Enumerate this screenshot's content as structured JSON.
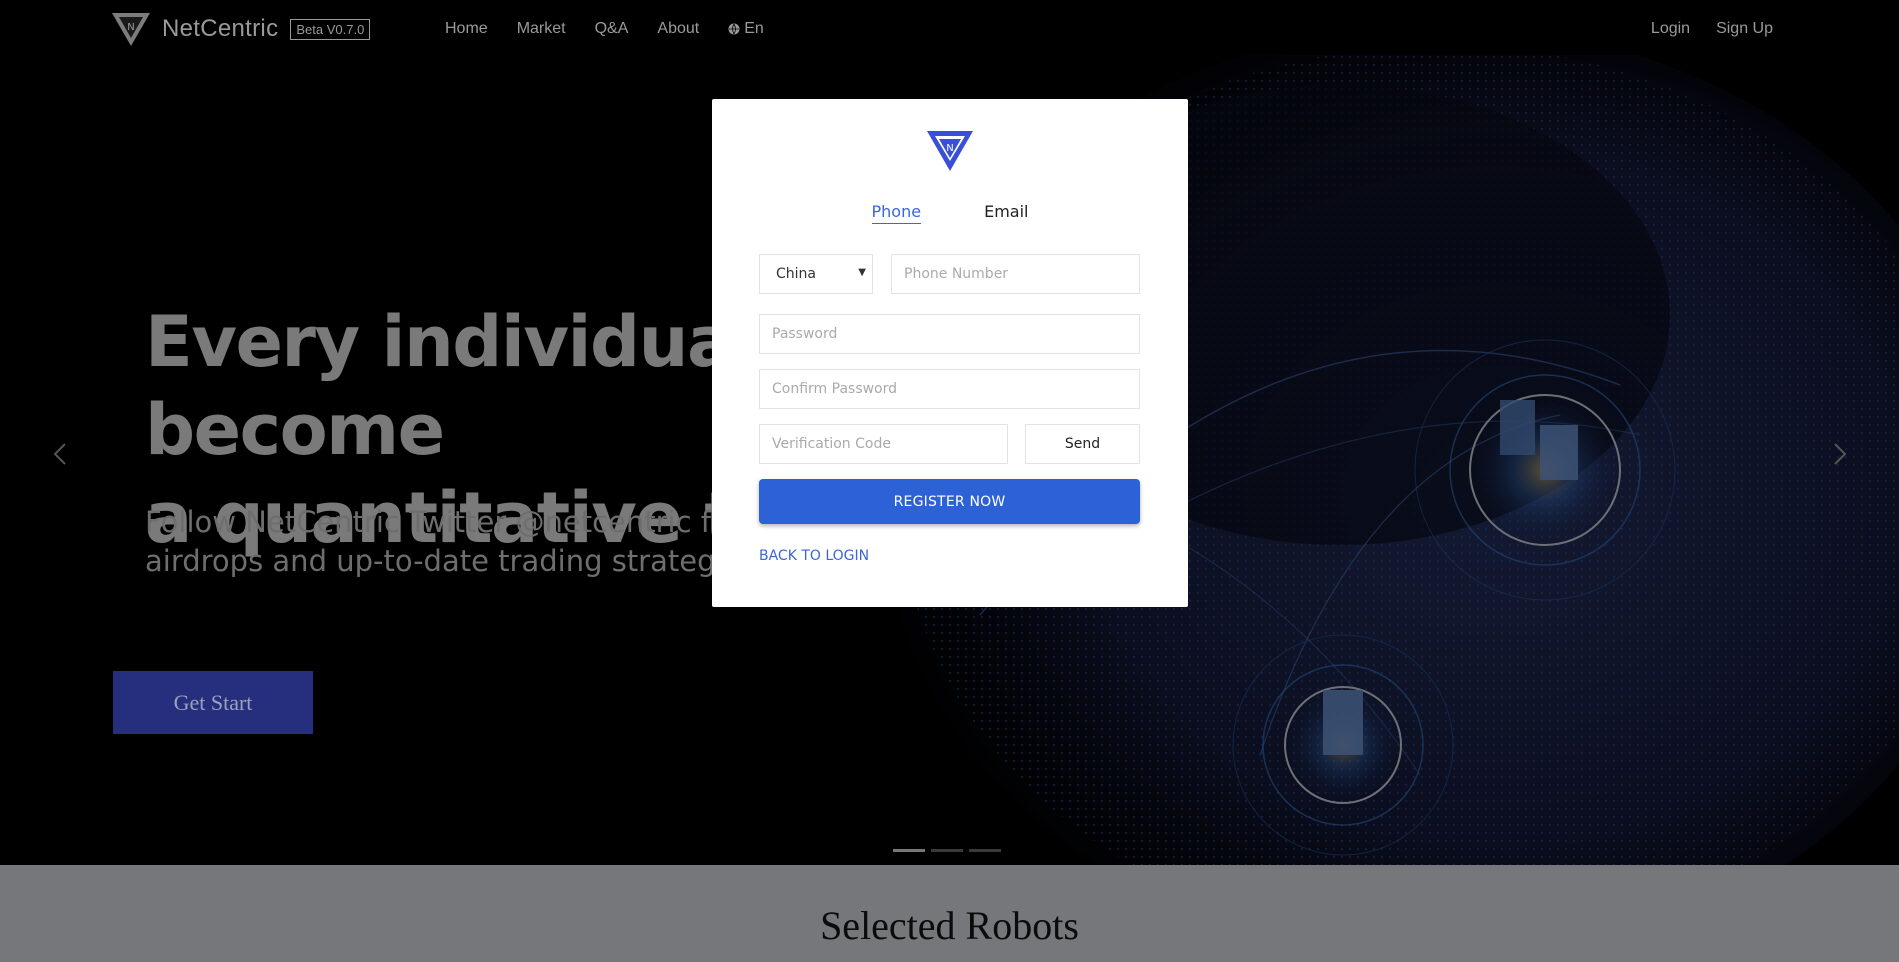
{
  "navbar": {
    "brand_name": "NetCentric",
    "beta_badge": "Beta V0.7.0",
    "links": [
      "Home",
      "Market",
      "Q&A",
      "About"
    ],
    "language": "En",
    "login": "Login",
    "signup": "Sign Up"
  },
  "hero": {
    "headline_line1": "Every individual is able to become",
    "headline_line2": "a quantitative trader",
    "subline_line1": "Follow NetCentric Twitter @netcentric for",
    "subline_line2": "airdrops and up-to-date trading strategies",
    "cta": "Get Start",
    "slides": 3,
    "active_slide": 1
  },
  "modal": {
    "tabs": [
      "Phone",
      "Email"
    ],
    "active_tab": "Phone",
    "country": "China",
    "phone_placeholder": "Phone Number",
    "password_placeholder": "Password",
    "confirm_placeholder": "Confirm Password",
    "code_placeholder": "Verification Code",
    "send_label": "Send",
    "register_label": "REGISTER NOW",
    "back_label": "BACK TO LOGIN"
  },
  "section": {
    "title": "Selected Robots"
  },
  "colors": {
    "accent": "#2d62d7",
    "cta_bg": "#262f7e",
    "logo_blue": "#3a4fd8"
  },
  "icons": {
    "brand": "netcentric-triangle-logo",
    "language": "globe-icon",
    "prev": "chevron-left-icon",
    "next": "chevron-right-icon"
  }
}
